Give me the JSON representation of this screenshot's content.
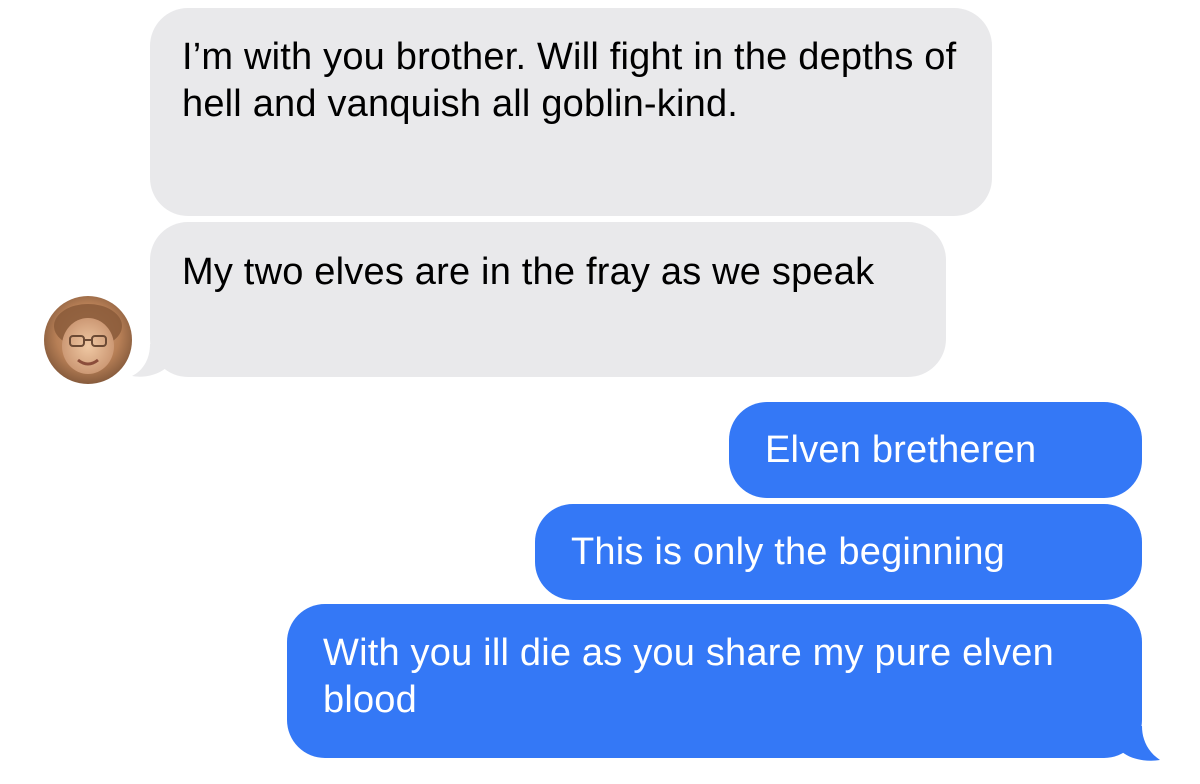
{
  "thread": {
    "messages": [
      {
        "direction": "incoming",
        "text": "I’m with you brother. Will fight in the depths of hell and vanquish all goblin-kind."
      },
      {
        "direction": "incoming",
        "text": "My two elves are in the fray as we speak"
      },
      {
        "direction": "outgoing",
        "text": "Elven bretheren"
      },
      {
        "direction": "outgoing",
        "text": "This is only the beginning"
      },
      {
        "direction": "outgoing",
        "text": "With you ill die as you share my pure elven blood"
      }
    ]
  },
  "colors": {
    "incoming_bubble": "#e9e9eb",
    "outgoing_bubble": "#3478f6",
    "outgoing_text": "#ffffff",
    "background": "#ffffff"
  },
  "icons": {
    "contact_avatar": "contact-avatar-photo"
  }
}
